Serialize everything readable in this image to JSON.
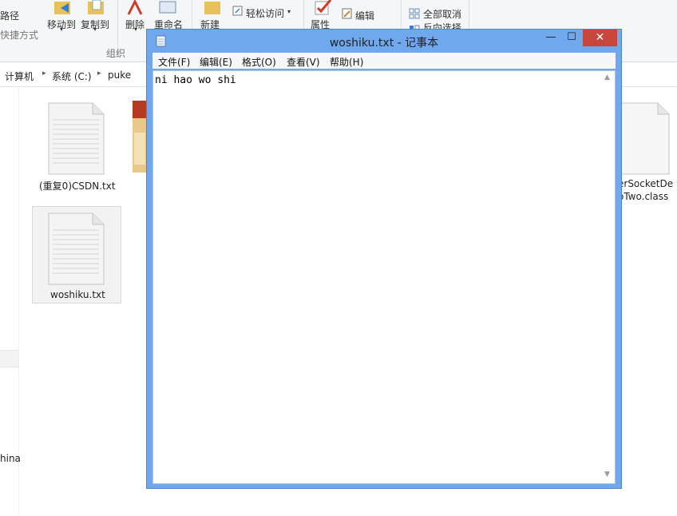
{
  "explorer": {
    "ribbon": {
      "path_label": "路径",
      "shortcut_label": "快捷方式",
      "move_to": "移动到",
      "copy_to": "复制到",
      "delete": "删除",
      "rename": "重命名",
      "organize": "组织",
      "new": "新建",
      "easy_access": "轻松访问",
      "properties": "属性",
      "edit": "编辑",
      "select_none": "全部取消",
      "invert_selection": "反向选择"
    },
    "breadcrumb": [
      "计算机",
      "系统 (C:)",
      "puke"
    ],
    "nav_text": "hina",
    "files": [
      {
        "name": "(重复0)CSDN.txt"
      },
      {
        "name": "woshiku.txt"
      },
      {
        "name_line1": "erSocketDe",
        "name_line2": "oTwo.class"
      }
    ]
  },
  "notepad": {
    "title": "woshiku.txt - 记事本",
    "menu": [
      "文件(F)",
      "编辑(E)",
      "格式(O)",
      "查看(V)",
      "帮助(H)"
    ],
    "content": "ni hao wo shi",
    "controls": {
      "minimize": "—",
      "maximize": "☐",
      "close": "✕"
    },
    "scroll": {
      "up": "▲",
      "down": "▼"
    }
  },
  "colors": {
    "title_bar": "#6fa8ec",
    "close_button": "#c8463b"
  }
}
